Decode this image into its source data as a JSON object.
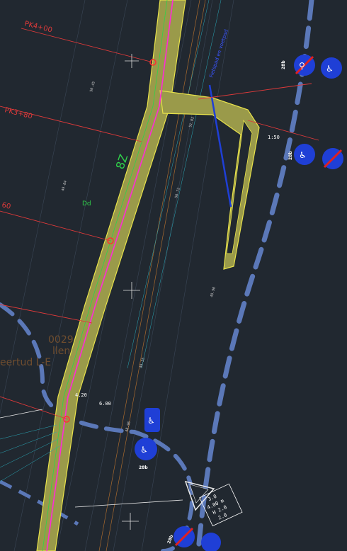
{
  "drawing": {
    "chainage_labels": [
      "PK4+00",
      "PK3+80",
      "60"
    ],
    "orange_text": {
      "line1": "0029",
      "line2": "llen",
      "line3": "eertud L-E"
    },
    "green_marks": [
      "8Z",
      "Dd"
    ],
    "sign_codes": [
      "28b",
      "28b",
      "28b",
      "28b",
      "28b"
    ],
    "sign_panel": [
      "3.0",
      "4.00 m",
      "H 2.0",
      "2.0"
    ],
    "blue_note": "Fietspad en voetpad",
    "scale_marks": [
      "1:50",
      "4.20",
      "6.00"
    ],
    "colors": {
      "background": "#212830",
      "cycle_path": "#9a9a4a",
      "centerline": "#ff2bd6",
      "chainage": "#e03a3a",
      "sign_blue": "#1f3fd6",
      "sign_red": "#e02020",
      "dashed_border": "#5b78b8"
    },
    "icons": [
      "bicycle-pedestrian-sign-icon",
      "no-cycling-sign-icon",
      "yield-triangle-icon",
      "crosshair-icon"
    ]
  }
}
